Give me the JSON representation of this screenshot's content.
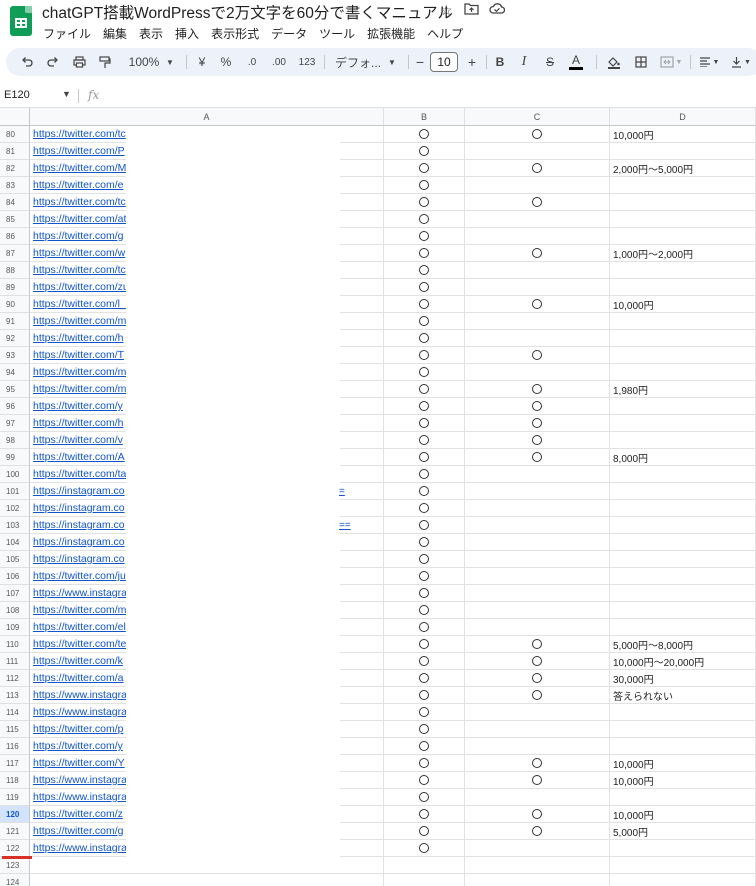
{
  "doc_title": "chatGPT搭載WordPressで2万文字を60分で書くマニュアル",
  "title_icons": [
    "star-icon",
    "move-to-folder-icon",
    "cloud-saved-icon"
  ],
  "menu": [
    "ファイル",
    "編集",
    "表示",
    "挿入",
    "表示形式",
    "データ",
    "ツール",
    "拡張機能",
    "ヘルプ"
  ],
  "toolbar": {
    "zoom": "100%",
    "currency": "¥",
    "percent": "%",
    "dec_decrease": ".0",
    "dec_increase": ".00",
    "number_format": "123",
    "font_name": "デフォ...",
    "font_size": "10",
    "minus": "−",
    "plus": "+",
    "bold": "B",
    "italic": "I",
    "strikethrough": "S",
    "text_color": "A"
  },
  "name_box": "E120",
  "fx_label": "fx",
  "columns": [
    "A",
    "B",
    "C",
    "D"
  ],
  "rows": [
    {
      "n": "80",
      "a": "https://twitter.com/tc",
      "b": true,
      "c": true,
      "d": "10,000円"
    },
    {
      "n": "81",
      "a": "https://twitter.com/P",
      "b": true,
      "c": false,
      "d": ""
    },
    {
      "n": "82",
      "a": "https://twitter.com/M",
      "b": true,
      "c": true,
      "d": "2,000円〜5,000円"
    },
    {
      "n": "83",
      "a": "https://twitter.com/e",
      "b": true,
      "c": false,
      "d": ""
    },
    {
      "n": "84",
      "a": "https://twitter.com/tc",
      "b": true,
      "c": true,
      "d": ""
    },
    {
      "n": "85",
      "a": "https://twitter.com/at",
      "b": true,
      "c": false,
      "d": ""
    },
    {
      "n": "86",
      "a": "https://twitter.com/g",
      "b": true,
      "c": false,
      "d": ""
    },
    {
      "n": "87",
      "a": "https://twitter.com/w",
      "b": true,
      "c": true,
      "d": "1,000円〜2,000円"
    },
    {
      "n": "88",
      "a": "https://twitter.com/tc",
      "b": true,
      "c": false,
      "d": ""
    },
    {
      "n": "89",
      "a": "https://twitter.com/zu",
      "b": true,
      "c": false,
      "d": ""
    },
    {
      "n": "90",
      "a": "https://twitter.com/l_",
      "b": true,
      "c": true,
      "d": "10,000円"
    },
    {
      "n": "91",
      "a": "https://twitter.com/m",
      "b": true,
      "c": false,
      "d": ""
    },
    {
      "n": "92",
      "a": "https://twitter.com/h",
      "b": true,
      "c": false,
      "d": ""
    },
    {
      "n": "93",
      "a": "https://twitter.com/T",
      "b": true,
      "c": true,
      "d": ""
    },
    {
      "n": "94",
      "a": "https://twitter.com/m",
      "b": true,
      "c": false,
      "d": ""
    },
    {
      "n": "95",
      "a": "https://twitter.com/m",
      "b": true,
      "c": true,
      "d": "1,980円"
    },
    {
      "n": "96",
      "a": "https://twitter.com/y",
      "b": true,
      "c": true,
      "d": ""
    },
    {
      "n": "97",
      "a": "https://twitter.com/h",
      "b": true,
      "c": true,
      "d": ""
    },
    {
      "n": "98",
      "a": "https://twitter.com/v",
      "b": true,
      "c": true,
      "d": ""
    },
    {
      "n": "99",
      "a": "https://twitter.com/A",
      "b": true,
      "c": true,
      "d": "8,000円"
    },
    {
      "n": "100",
      "a": "https://twitter.com/ta",
      "b": true,
      "c": false,
      "d": ""
    },
    {
      "n": "101",
      "a": "https://instagram.co",
      "b": true,
      "c": false,
      "d": ""
    },
    {
      "n": "102",
      "a": "https://instagram.co",
      "b": true,
      "c": false,
      "d": ""
    },
    {
      "n": "103",
      "a": "https://instagram.co",
      "b": true,
      "c": false,
      "d": ""
    },
    {
      "n": "104",
      "a": "https://instagram.co",
      "b": true,
      "c": false,
      "d": ""
    },
    {
      "n": "105",
      "a": "https://instagram.co",
      "b": true,
      "c": false,
      "d": ""
    },
    {
      "n": "106",
      "a": "https://twitter.com/ju",
      "b": true,
      "c": false,
      "d": ""
    },
    {
      "n": "107",
      "a": "https://www.instagra",
      "b": true,
      "c": false,
      "d": ""
    },
    {
      "n": "108",
      "a": "https://twitter.com/m",
      "b": true,
      "c": false,
      "d": ""
    },
    {
      "n": "109",
      "a": "https://twitter.com/el",
      "b": true,
      "c": false,
      "d": ""
    },
    {
      "n": "110",
      "a": "https://twitter.com/te",
      "b": true,
      "c": true,
      "d": "5,000円〜8,000円"
    },
    {
      "n": "111",
      "a": "https://twitter.com/k",
      "b": true,
      "c": true,
      "d": "10,000円〜20,000円"
    },
    {
      "n": "112",
      "a": "https://twitter.com/a",
      "b": true,
      "c": true,
      "d": "30,000円"
    },
    {
      "n": "113",
      "a": "https://www.instagra",
      "b": true,
      "c": true,
      "d": "答えられない"
    },
    {
      "n": "114",
      "a": "https://www.instagra",
      "b": true,
      "c": false,
      "d": ""
    },
    {
      "n": "115",
      "a": "https://twitter.com/p",
      "b": true,
      "c": false,
      "d": ""
    },
    {
      "n": "116",
      "a": "https://twitter.com/y",
      "b": true,
      "c": false,
      "d": ""
    },
    {
      "n": "117",
      "a": "https://twitter.com/Y",
      "b": true,
      "c": true,
      "d": "10,000円"
    },
    {
      "n": "118",
      "a": "https://www.instagra",
      "b": true,
      "c": true,
      "d": "10,000円"
    },
    {
      "n": "119",
      "a": "https://www.instagra",
      "b": true,
      "c": false,
      "d": ""
    },
    {
      "n": "120",
      "a": "https://twitter.com/z",
      "b": true,
      "c": true,
      "d": "10,000円"
    },
    {
      "n": "121",
      "a": "https://twitter.com/g",
      "b": true,
      "c": true,
      "d": "5,000円"
    },
    {
      "n": "122",
      "a": "https://www.instagra",
      "b": true,
      "c": false,
      "d": ""
    },
    {
      "n": "123",
      "a": "",
      "b": false,
      "c": false,
      "d": ""
    },
    {
      "n": "124",
      "a": "",
      "b": false,
      "c": false,
      "d": ""
    }
  ],
  "overflow_links": {
    "row101": "=",
    "row103": "=="
  },
  "active_row": "120",
  "colors": {
    "link": "#1155cc",
    "accent_red": "#d93025",
    "selection": "#d3e3fd",
    "logo_green": "#0f9d58"
  }
}
